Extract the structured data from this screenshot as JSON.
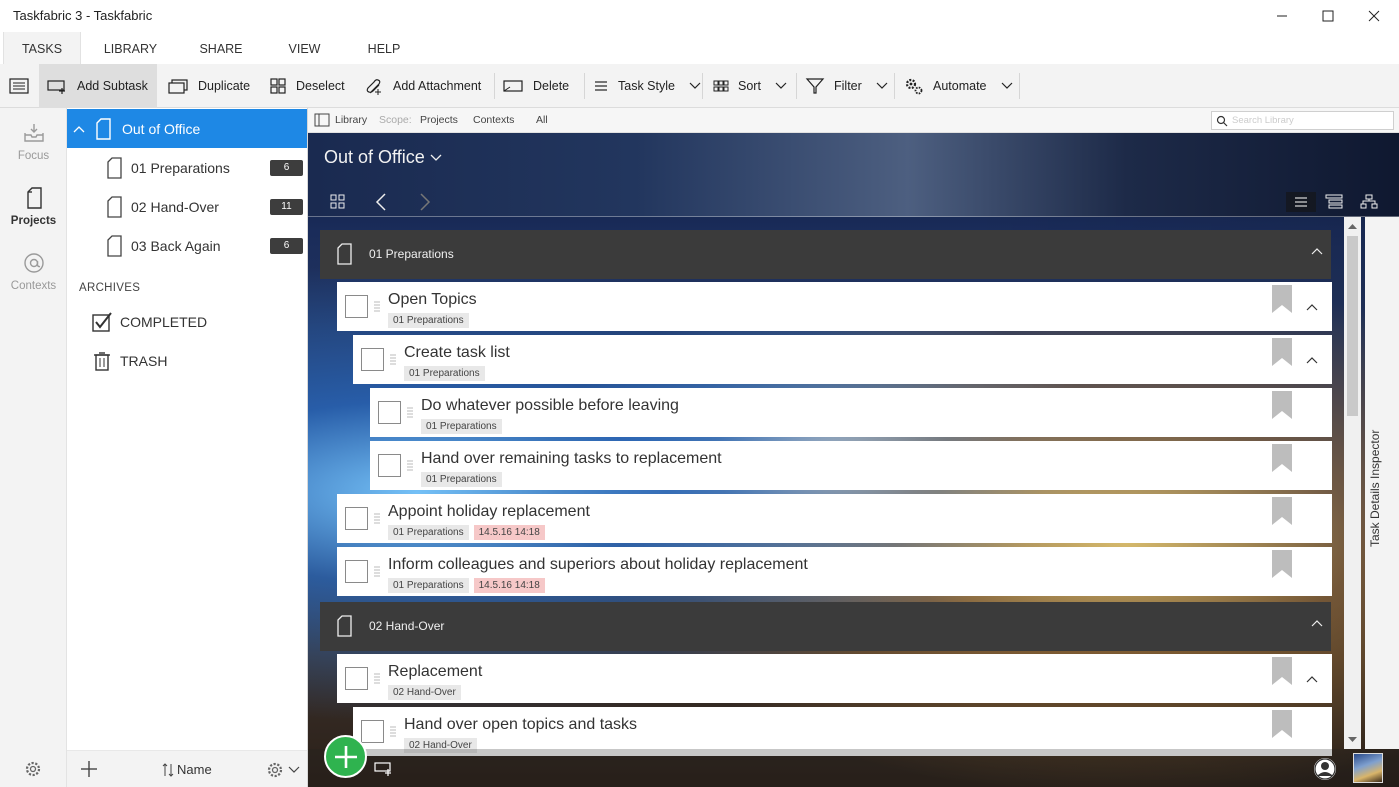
{
  "window": {
    "title": "Taskfabric 3 - Taskfabric"
  },
  "tabs": [
    "TASKS",
    "LIBRARY",
    "SHARE",
    "VIEW",
    "HELP"
  ],
  "toolbar": {
    "add_subtask": "Add Subtask",
    "duplicate": "Duplicate",
    "deselect": "Deselect",
    "add_attachment": "Add Attachment",
    "delete": "Delete",
    "task_style": "Task Style",
    "sort": "Sort",
    "filter": "Filter",
    "automate": "Automate"
  },
  "rail": {
    "focus": "Focus",
    "projects": "Projects",
    "contexts": "Contexts"
  },
  "projects": {
    "root": "Out of Office",
    "children": [
      {
        "name": "01 Preparations",
        "count": "6"
      },
      {
        "name": "02 Hand-Over",
        "count": "11"
      },
      {
        "name": "03 Back Again",
        "count": "6"
      }
    ],
    "archives_label": "ARCHIVES",
    "completed": "COMPLETED",
    "trash": "TRASH",
    "sort_label": "Name"
  },
  "scope": {
    "library": "Library",
    "scope_label": "Scope:",
    "projects": "Projects",
    "contexts": "Contexts",
    "all": "All",
    "search_placeholder": "Search Library"
  },
  "view": {
    "title": "Out of Office",
    "inspector": "Task Details Inspector"
  },
  "groups": [
    {
      "name": "01 Preparations"
    },
    {
      "name": "02 Hand-Over"
    }
  ],
  "tasks": [
    {
      "name": "Open Topics",
      "tag": "01 Preparations",
      "date": ""
    },
    {
      "name": "Create task list",
      "tag": "01 Preparations",
      "date": ""
    },
    {
      "name": "Do whatever possible before leaving",
      "tag": "01 Preparations",
      "date": ""
    },
    {
      "name": "Hand over remaining tasks to replacement",
      "tag": "01 Preparations",
      "date": ""
    },
    {
      "name": "Appoint holiday replacement",
      "tag": "01 Preparations",
      "date": "14.5.16 14:18"
    },
    {
      "name": "Inform colleagues and superiors about holiday replacement",
      "tag": "01 Preparations",
      "date": "14.5.16 14:18"
    },
    {
      "name": "Replacement",
      "tag": "02 Hand-Over",
      "date": ""
    },
    {
      "name": "Hand over open topics and tasks",
      "tag": "02 Hand-Over",
      "date": ""
    }
  ],
  "colors": {
    "accent": "#1e88e5",
    "fab": "#2fb34f",
    "group_bar": "#3b3b3b",
    "date_tag": "#f6c8c8"
  }
}
